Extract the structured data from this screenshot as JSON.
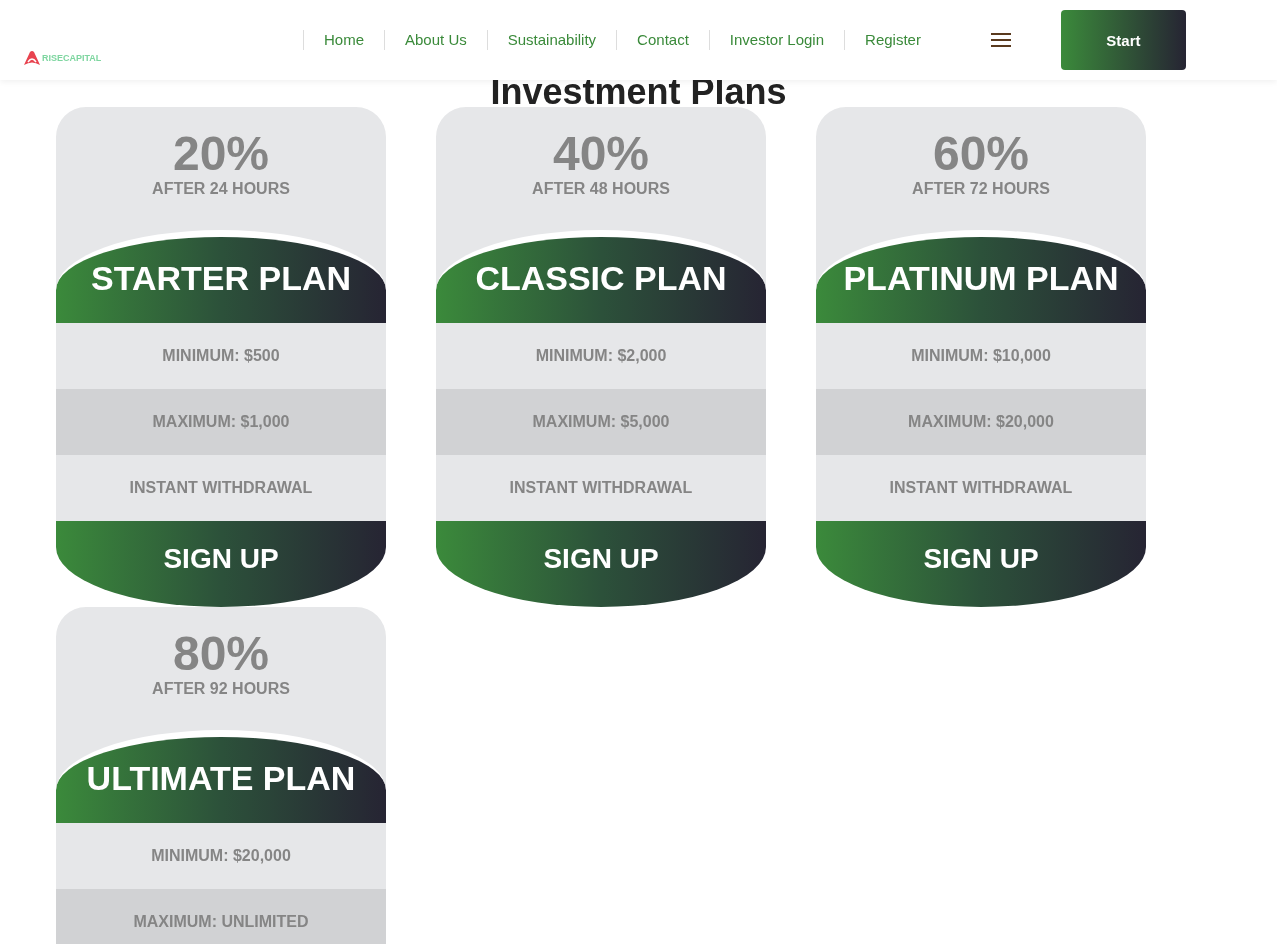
{
  "header": {
    "logo_text": "RISECAPITAL",
    "nav": [
      {
        "label": "Home"
      },
      {
        "label": "About Us"
      },
      {
        "label": "Sustainability"
      },
      {
        "label": "Contact"
      },
      {
        "label": "Investor Login"
      },
      {
        "label": "Register"
      }
    ],
    "start_button": "Start"
  },
  "title": "Investment Plans",
  "plans": [
    {
      "rate": "20%",
      "period": "AFTER 24 HOURS",
      "name": "STARTER PLAN",
      "rows": [
        "MINIMUM: $500",
        "MAXIMUM: $1,000",
        "INSTANT WITHDRAWAL"
      ],
      "button": "SIGN UP"
    },
    {
      "rate": "40%",
      "period": "AFTER 48 HOURS",
      "name": "CLASSIC PLAN",
      "rows": [
        "MINIMUM: $2,000",
        "MAXIMUM: $5,000",
        "INSTANT WITHDRAWAL"
      ],
      "button": "SIGN UP"
    },
    {
      "rate": "60%",
      "period": "AFTER 72 HOURS",
      "name": "PLATINUM PLAN",
      "rows": [
        "MINIMUM: $10,000",
        "MAXIMUM: $20,000",
        "INSTANT WITHDRAWAL"
      ],
      "button": "SIGN UP"
    },
    {
      "rate": "80%",
      "period": "AFTER 92 HOURS",
      "name": "ULTIMATE PLAN",
      "rows": [
        "MINIMUM: $20,000",
        "MAXIMUM: UNLIMITED"
      ]
    }
  ]
}
